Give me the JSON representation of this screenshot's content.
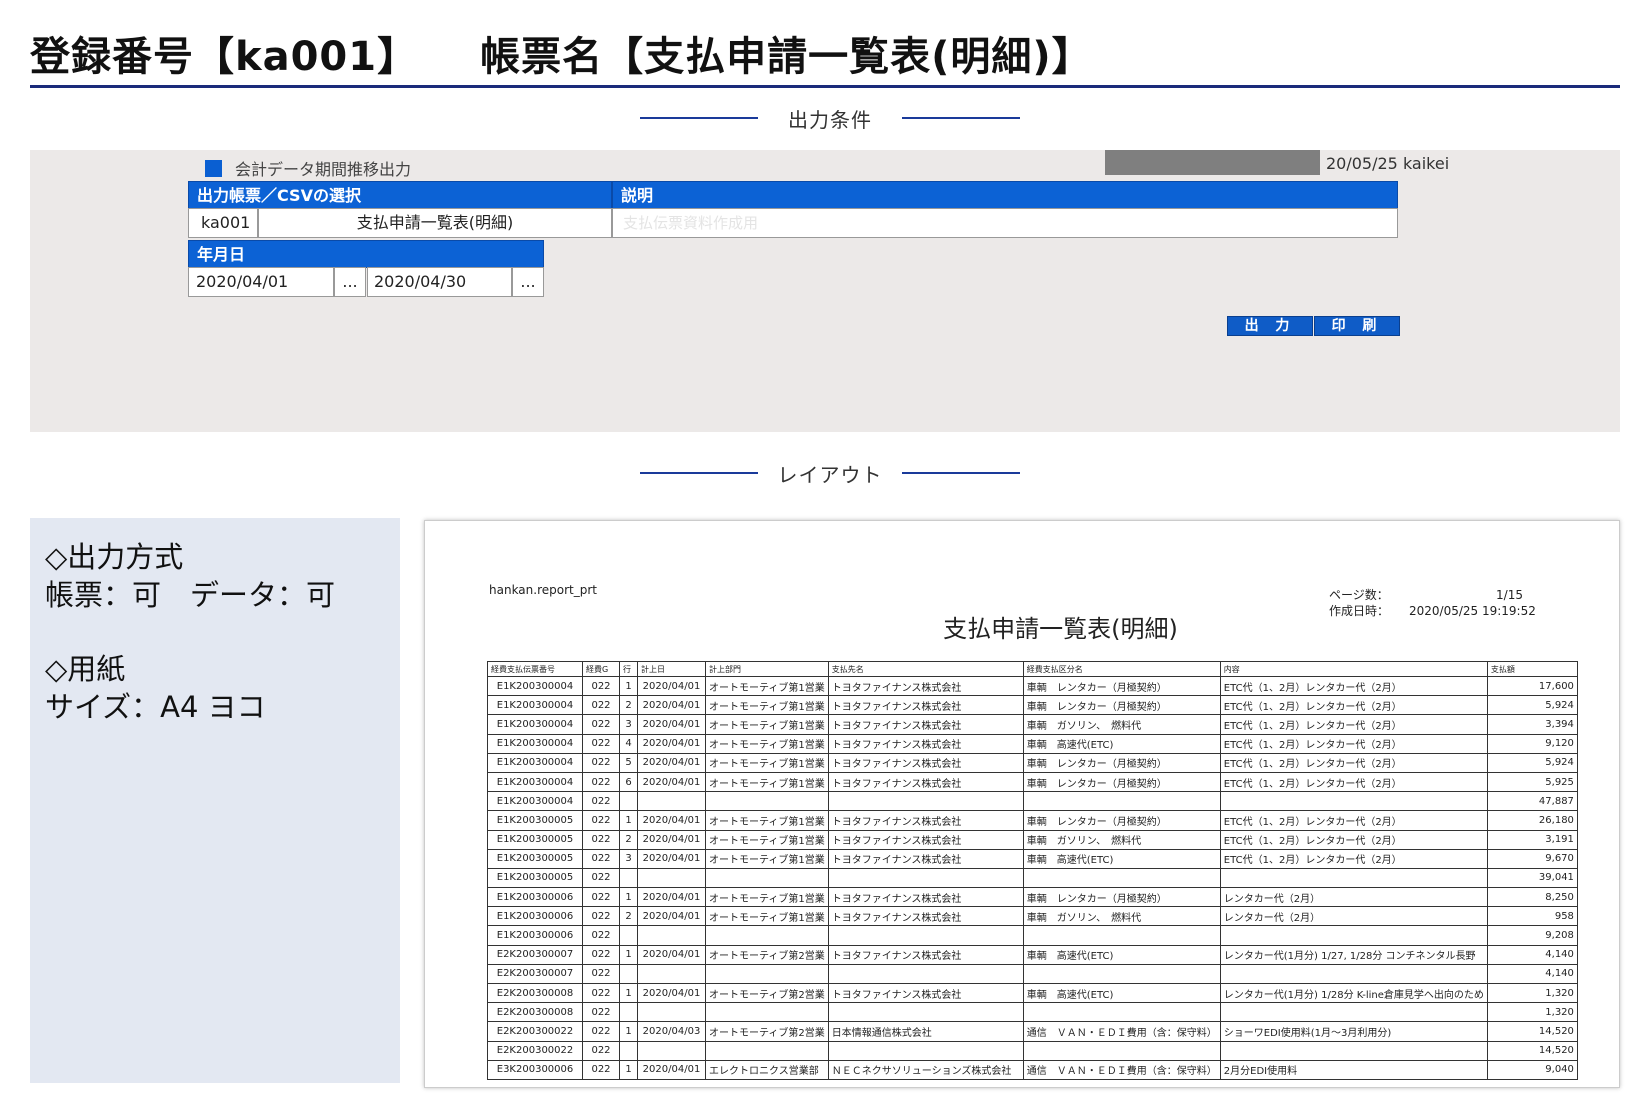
{
  "header": {
    "reg_no": "登録番号【ka001】",
    "form_name": "帳票名【支払申請一覧表(明細)】"
  },
  "sections": {
    "conditions": "出力条件",
    "layout": "レイアウト"
  },
  "screen": {
    "menu_title": "会計データ期間推移出力",
    "user_info": "20/05/25 kaikei",
    "form_select_header": "出力帳票／CSVの選択",
    "desc_header": "説明",
    "form_code": "ka001",
    "form_label": "支払申請一覧表(明細)",
    "form_desc": "支払伝票資料作成用",
    "date_header": "年月日",
    "date_from": "2020/04/01",
    "date_to": "2020/04/30",
    "ellipsis": "...",
    "output_button": "出 力",
    "print_button": "印 刷"
  },
  "info": {
    "output_heading": "◇出力方式",
    "output_value": "帳票：可　データ：可",
    "paper_heading": "◇用紙",
    "paper_value": "サイズ：A4 ヨコ"
  },
  "report": {
    "program": "hankan.report_prt",
    "title": "支払申請一覧表(明細)",
    "page_label": "ページ数：",
    "page_value": "1/15",
    "created_label": "作成日時：",
    "created_value": "2020/05/25 19:19:52",
    "columns": [
      "経費支払伝票番号",
      "経費G",
      "行",
      "計上日",
      "計上部門",
      "支払先名",
      "経費支払区分名",
      "内容",
      "支払額"
    ],
    "rows": [
      [
        "E1K200300004",
        "022",
        "1",
        "2020/04/01",
        "オートモーティブ第1営業",
        "トヨタファイナンス株式会社",
        "車輌　レンタカー（月極契約）",
        "ETC代（1、2月）レンタカー代（2月）",
        "17,600"
      ],
      [
        "E1K200300004",
        "022",
        "2",
        "2020/04/01",
        "オートモーティブ第1営業",
        "トヨタファイナンス株式会社",
        "車輌　レンタカー（月極契約）",
        "ETC代（1、2月）レンタカー代（2月）",
        "5,924"
      ],
      [
        "E1K200300004",
        "022",
        "3",
        "2020/04/01",
        "オートモーティブ第1営業",
        "トヨタファイナンス株式会社",
        "車輌　ガソリン、　燃料代",
        "ETC代（1、2月）レンタカー代（2月）",
        "3,394"
      ],
      [
        "E1K200300004",
        "022",
        "4",
        "2020/04/01",
        "オートモーティブ第1営業",
        "トヨタファイナンス株式会社",
        "車輌　高速代(ETC)",
        "ETC代（1、2月）レンタカー代（2月）",
        "9,120"
      ],
      [
        "E1K200300004",
        "022",
        "5",
        "2020/04/01",
        "オートモーティブ第1営業",
        "トヨタファイナンス株式会社",
        "車輌　レンタカー（月極契約）",
        "ETC代（1、2月）レンタカー代（2月）",
        "5,924"
      ],
      [
        "E1K200300004",
        "022",
        "6",
        "2020/04/01",
        "オートモーティブ第1営業",
        "トヨタファイナンス株式会社",
        "車輌　レンタカー（月極契約）",
        "ETC代（1、2月）レンタカー代（2月）",
        "5,925"
      ],
      [
        "E1K200300004",
        "022",
        "",
        "",
        "",
        "",
        "",
        "",
        "47,887"
      ],
      [
        "E1K200300005",
        "022",
        "1",
        "2020/04/01",
        "オートモーティブ第1営業",
        "トヨタファイナンス株式会社",
        "車輌　レンタカー（月極契約）",
        "ETC代（1、2月）レンタカー代（2月）",
        "26,180"
      ],
      [
        "E1K200300005",
        "022",
        "2",
        "2020/04/01",
        "オートモーティブ第1営業",
        "トヨタファイナンス株式会社",
        "車輌　ガソリン、　燃料代",
        "ETC代（1、2月）レンタカー代（2月）",
        "3,191"
      ],
      [
        "E1K200300005",
        "022",
        "3",
        "2020/04/01",
        "オートモーティブ第1営業",
        "トヨタファイナンス株式会社",
        "車輌　高速代(ETC)",
        "ETC代（1、2月）レンタカー代（2月）",
        "9,670"
      ],
      [
        "E1K200300005",
        "022",
        "",
        "",
        "",
        "",
        "",
        "",
        "39,041"
      ],
      [
        "E1K200300006",
        "022",
        "1",
        "2020/04/01",
        "オートモーティブ第1営業",
        "トヨタファイナンス株式会社",
        "車輌　レンタカー（月極契約）",
        "レンタカー代（2月）",
        "8,250"
      ],
      [
        "E1K200300006",
        "022",
        "2",
        "2020/04/01",
        "オートモーティブ第1営業",
        "トヨタファイナンス株式会社",
        "車輌　ガソリン、　燃料代",
        "レンタカー代（2月）",
        "958"
      ],
      [
        "E1K200300006",
        "022",
        "",
        "",
        "",
        "",
        "",
        "",
        "9,208"
      ],
      [
        "E2K200300007",
        "022",
        "1",
        "2020/04/01",
        "オートモーティブ第2営業",
        "トヨタファイナンス株式会社",
        "車輌　高速代(ETC)",
        "レンタカー代(1月分) 1/27, 1/28分 コンチネンタル長野",
        "4,140"
      ],
      [
        "E2K200300007",
        "022",
        "",
        "",
        "",
        "",
        "",
        "",
        "4,140"
      ],
      [
        "E2K200300008",
        "022",
        "1",
        "2020/04/01",
        "オートモーティブ第2営業",
        "トヨタファイナンス株式会社",
        "車輌　高速代(ETC)",
        "レンタカー代(1月分) 1/28分 K-line倉庫見学へ出向のため",
        "1,320"
      ],
      [
        "E2K200300008",
        "022",
        "",
        "",
        "",
        "",
        "",
        "",
        "1,320"
      ],
      [
        "E2K200300022",
        "022",
        "1",
        "2020/04/03",
        "オートモーティブ第2営業",
        "日本情報通信株式会社",
        "通信　ＶＡＮ・ＥＤＩ費用（含：保守料）",
        "ショーワEDI使用料(1月～3月利用分)",
        "14,520"
      ],
      [
        "E2K200300022",
        "022",
        "",
        "",
        "",
        "",
        "",
        "",
        "14,520"
      ],
      [
        "E3K200300006",
        "022",
        "1",
        "2020/04/01",
        "エレクトロニクス営業部",
        "ＮＥＣネクサソリューションズ株式会社",
        "通信　ＶＡＮ・ＥＤＩ費用（含：保守料）",
        "2月分EDI使用料",
        "9,040"
      ]
    ]
  }
}
